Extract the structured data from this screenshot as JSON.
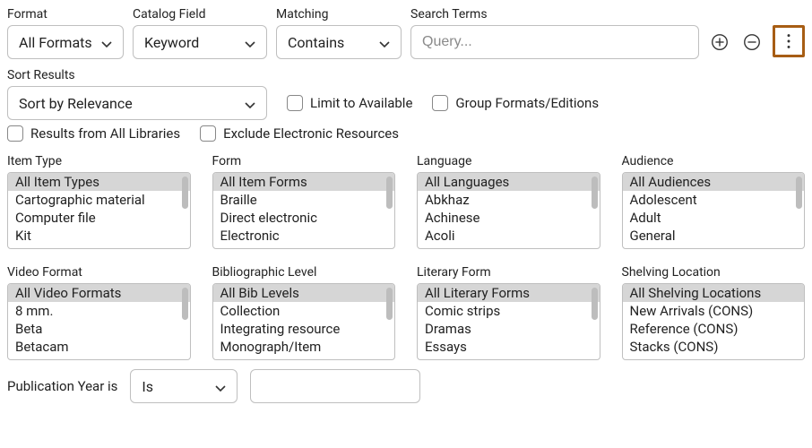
{
  "top": {
    "format": {
      "label": "Format",
      "value": "All Formats"
    },
    "catalog_field": {
      "label": "Catalog Field",
      "value": "Keyword"
    },
    "matching": {
      "label": "Matching",
      "value": "Contains"
    },
    "search_terms": {
      "label": "Search Terms",
      "placeholder": "Query..."
    }
  },
  "sort": {
    "label": "Sort Results",
    "value": "Sort by Relevance"
  },
  "checks": {
    "limit_available": "Limit to Available",
    "group_formats": "Group Formats/Editions",
    "all_libraries": "Results from All Libraries",
    "exclude_electronic": "Exclude Electronic Resources"
  },
  "facets": {
    "item_type": {
      "label": "Item Type",
      "items": [
        "All Item Types",
        "Cartographic material",
        "Computer file",
        "Kit"
      ],
      "selected": 0
    },
    "form": {
      "label": "Form",
      "items": [
        "All Item Forms",
        "Braille",
        "Direct electronic",
        "Electronic"
      ],
      "selected": 0
    },
    "language": {
      "label": "Language",
      "items": [
        "All Languages",
        "Abkhaz",
        "Achinese",
        "Acoli"
      ],
      "selected": 0
    },
    "audience": {
      "label": "Audience",
      "items": [
        "All Audiences",
        "Adolescent",
        "Adult",
        "General"
      ],
      "selected": 0
    },
    "video_format": {
      "label": "Video Format",
      "items": [
        "All Video Formats",
        "8 mm.",
        "Beta",
        "Betacam"
      ],
      "selected": 0
    },
    "bib_level": {
      "label": "Bibliographic Level",
      "items": [
        "All Bib Levels",
        "Collection",
        "Integrating resource",
        "Monograph/Item"
      ],
      "selected": 0
    },
    "literary_form": {
      "label": "Literary Form",
      "items": [
        "All Literary Forms",
        "Comic strips",
        "Dramas",
        "Essays"
      ],
      "selected": 0
    },
    "shelving_location": {
      "label": "Shelving Location",
      "items": [
        "All Shelving Locations",
        "New Arrivals (CONS)",
        "Reference (CONS)",
        "Stacks (CONS)"
      ],
      "selected": 0
    }
  },
  "pubyear": {
    "label": "Publication Year is",
    "value": "Is"
  }
}
